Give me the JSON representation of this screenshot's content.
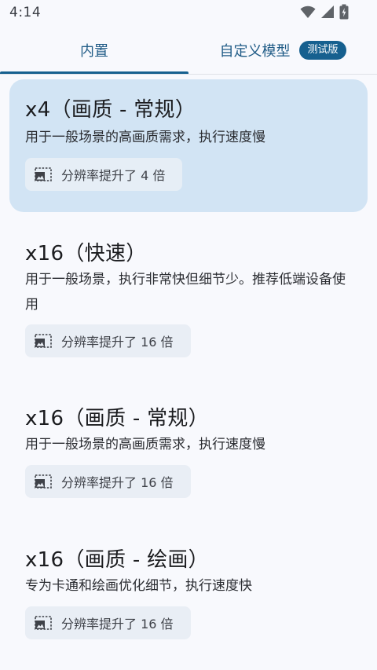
{
  "status_bar": {
    "time": "4:14",
    "icons": [
      "wifi-icon",
      "signal-icon",
      "battery-icon"
    ]
  },
  "tabs": [
    {
      "label": "内置",
      "selected": true
    },
    {
      "label": "自定义模型",
      "badge": "测试版",
      "selected": false
    }
  ],
  "models": [
    {
      "title": "x4（画质 - 常规）",
      "desc": "用于一般场景的高画质需求，执行速度慢",
      "chip": "分辨率提升了 4 倍",
      "selected": true
    },
    {
      "title": "x16（快速）",
      "desc": "用于一般场景，执行非常快但细节少。推荐低端设备使用",
      "chip": "分辨率提升了 16 倍",
      "selected": false
    },
    {
      "title": "x16（画质 - 常规）",
      "desc": "用于一般场景的高画质需求，执行速度慢",
      "chip": "分辨率提升了 16 倍",
      "selected": false
    },
    {
      "title": "x16（画质 - 绘画）",
      "desc": "专为卡通和绘画优化细节，执行速度快",
      "chip": "分辨率提升了 16 倍",
      "selected": false
    }
  ],
  "colors": {
    "accent": "#16608f",
    "selected_card": "#d2e4f4",
    "chip_bg": "#e9eef5",
    "background": "#f8f9fd"
  }
}
